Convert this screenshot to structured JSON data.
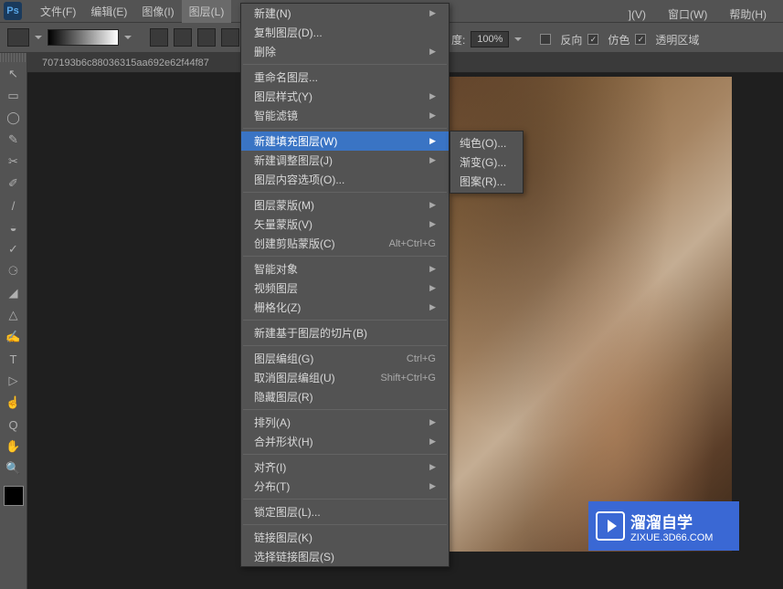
{
  "app": {
    "logo": "Ps"
  },
  "menubar": {
    "items": [
      {
        "label": "文件(F)"
      },
      {
        "label": "编辑(E)"
      },
      {
        "label": "图像(I)"
      },
      {
        "label": "图层(L)"
      }
    ],
    "right": [
      {
        "label": "](V)"
      },
      {
        "label": "窗口(W)"
      },
      {
        "label": "帮助(H)"
      }
    ]
  },
  "options": {
    "dulabel": "度:",
    "percent": "100%",
    "inverse": "反向",
    "dither": "仿色",
    "transparent": "透明区域"
  },
  "doc": {
    "name": "707193b6c88036315aa692e62f44f87"
  },
  "dropdown": {
    "groups": [
      [
        {
          "label": "新建(N)",
          "arrow": true
        },
        {
          "label": "复制图层(D)..."
        },
        {
          "label": "删除",
          "arrow": true
        }
      ],
      [
        {
          "label": "重命名图层..."
        },
        {
          "label": "图层样式(Y)",
          "arrow": true
        },
        {
          "label": "智能滤镜",
          "arrow": true
        }
      ],
      [
        {
          "label": "新建填充图层(W)",
          "arrow": true,
          "highlighted": true
        },
        {
          "label": "新建调整图层(J)",
          "arrow": true
        },
        {
          "label": "图层内容选项(O)..."
        }
      ],
      [
        {
          "label": "图层蒙版(M)",
          "arrow": true
        },
        {
          "label": "矢量蒙版(V)",
          "arrow": true
        },
        {
          "label": "创建剪贴蒙版(C)",
          "shortcut": "Alt+Ctrl+G"
        }
      ],
      [
        {
          "label": "智能对象",
          "arrow": true
        },
        {
          "label": "视频图层",
          "arrow": true
        },
        {
          "label": "栅格化(Z)",
          "arrow": true
        }
      ],
      [
        {
          "label": "新建基于图层的切片(B)"
        }
      ],
      [
        {
          "label": "图层编组(G)",
          "shortcut": "Ctrl+G"
        },
        {
          "label": "取消图层编组(U)",
          "shortcut": "Shift+Ctrl+G"
        },
        {
          "label": "隐藏图层(R)"
        }
      ],
      [
        {
          "label": "排列(A)",
          "arrow": true
        },
        {
          "label": "合并形状(H)",
          "arrow": true
        }
      ],
      [
        {
          "label": "对齐(I)",
          "arrow": true
        },
        {
          "label": "分布(T)",
          "arrow": true
        }
      ],
      [
        {
          "label": "锁定图层(L)..."
        }
      ],
      [
        {
          "label": "链接图层(K)"
        },
        {
          "label": "选择链接图层(S)"
        }
      ]
    ]
  },
  "submenu": {
    "items": [
      {
        "label": "纯色(O)..."
      },
      {
        "label": "渐变(G)..."
      },
      {
        "label": "图案(R)..."
      }
    ]
  },
  "watermark": {
    "title": "溜溜自学",
    "url": "ZIXUE.3D66.COM"
  },
  "tools": [
    "↖",
    "▭",
    "◯",
    "✎",
    "✂",
    "✐",
    "/",
    "◒",
    "✓",
    "⚆",
    "◢",
    "△",
    "✍",
    "T",
    "▷",
    "☝",
    "Q",
    "✋",
    "🔍"
  ]
}
